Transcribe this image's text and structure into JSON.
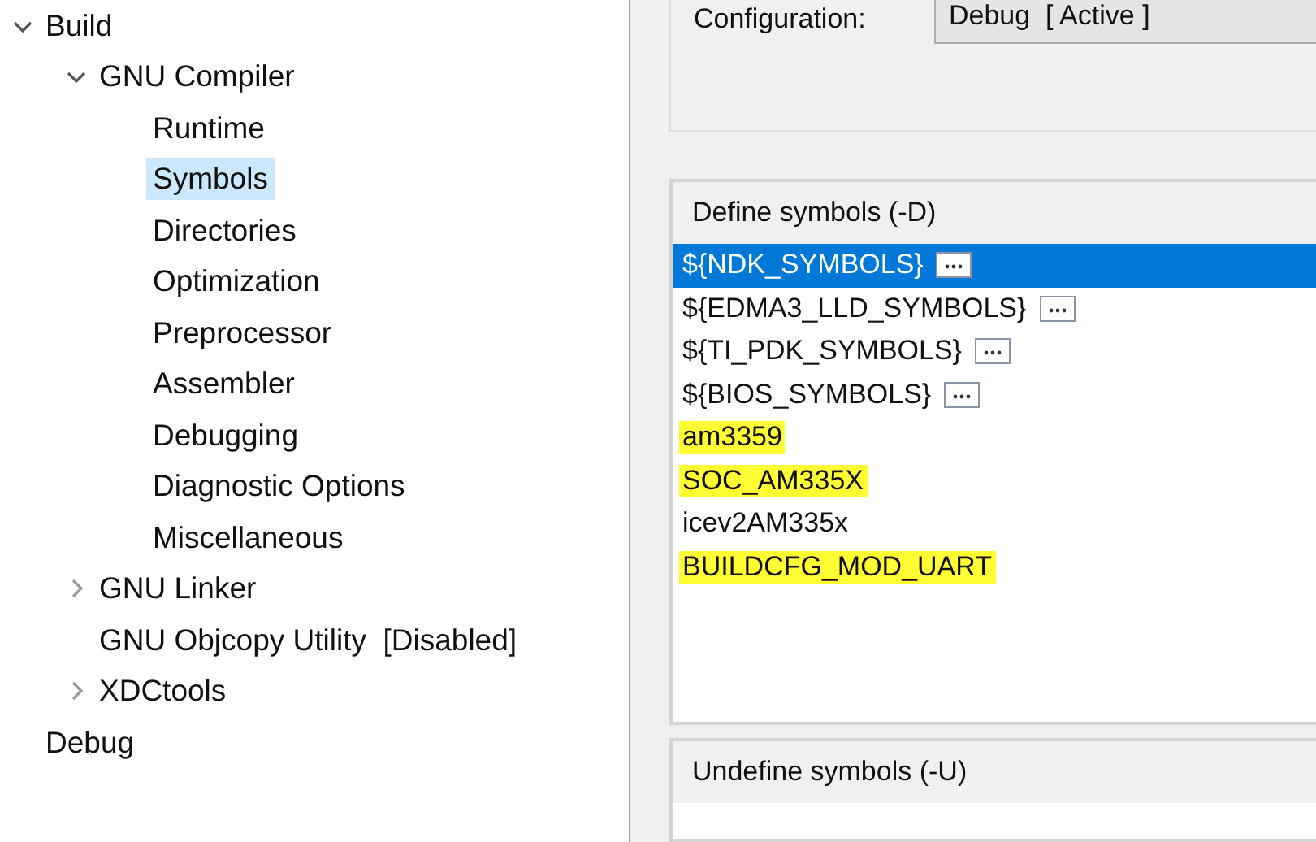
{
  "tree": [
    {
      "label": "Build",
      "expanded": true,
      "selected": false,
      "children": [
        {
          "label": "GNU Compiler",
          "expanded": true,
          "selected": false,
          "children": [
            {
              "label": "Runtime",
              "selected": false
            },
            {
              "label": "Symbols",
              "selected": true
            },
            {
              "label": "Directories",
              "selected": false
            },
            {
              "label": "Optimization",
              "selected": false
            },
            {
              "label": "Preprocessor",
              "selected": false
            },
            {
              "label": "Assembler",
              "selected": false
            },
            {
              "label": "Debugging",
              "selected": false
            },
            {
              "label": "Diagnostic Options",
              "selected": false
            },
            {
              "label": "Miscellaneous",
              "selected": false
            }
          ]
        },
        {
          "label": "GNU Linker",
          "expanded": false,
          "selected": false
        },
        {
          "label": "GNU Objcopy Utility  [Disabled]",
          "selected": false
        },
        {
          "label": "XDCtools",
          "expanded": false,
          "selected": false
        }
      ]
    },
    {
      "label": "Debug",
      "selected": false
    }
  ],
  "configuration": {
    "label": "Configuration:",
    "value": "Debug  [ Active ]"
  },
  "define_symbols": {
    "title": "Define symbols (-D)",
    "items": [
      {
        "text": "${NDK_SYMBOLS}",
        "kind": "variable",
        "selected": true,
        "highlighted": false
      },
      {
        "text": "${EDMA3_LLD_SYMBOLS}",
        "kind": "variable",
        "selected": false,
        "highlighted": false
      },
      {
        "text": "${TI_PDK_SYMBOLS}",
        "kind": "variable",
        "selected": false,
        "highlighted": false
      },
      {
        "text": "${BIOS_SYMBOLS}",
        "kind": "variable",
        "selected": false,
        "highlighted": false
      },
      {
        "text": "am3359",
        "kind": "plain",
        "selected": false,
        "highlighted": true
      },
      {
        "text": "SOC_AM335X",
        "kind": "plain",
        "selected": false,
        "highlighted": true
      },
      {
        "text": "icev2AM335x",
        "kind": "plain",
        "selected": false,
        "highlighted": false
      },
      {
        "text": "BUILDCFG_MOD_UART",
        "kind": "plain",
        "selected": false,
        "highlighted": true
      }
    ]
  },
  "undefine_symbols": {
    "title": "Undefine symbols (-U)"
  }
}
